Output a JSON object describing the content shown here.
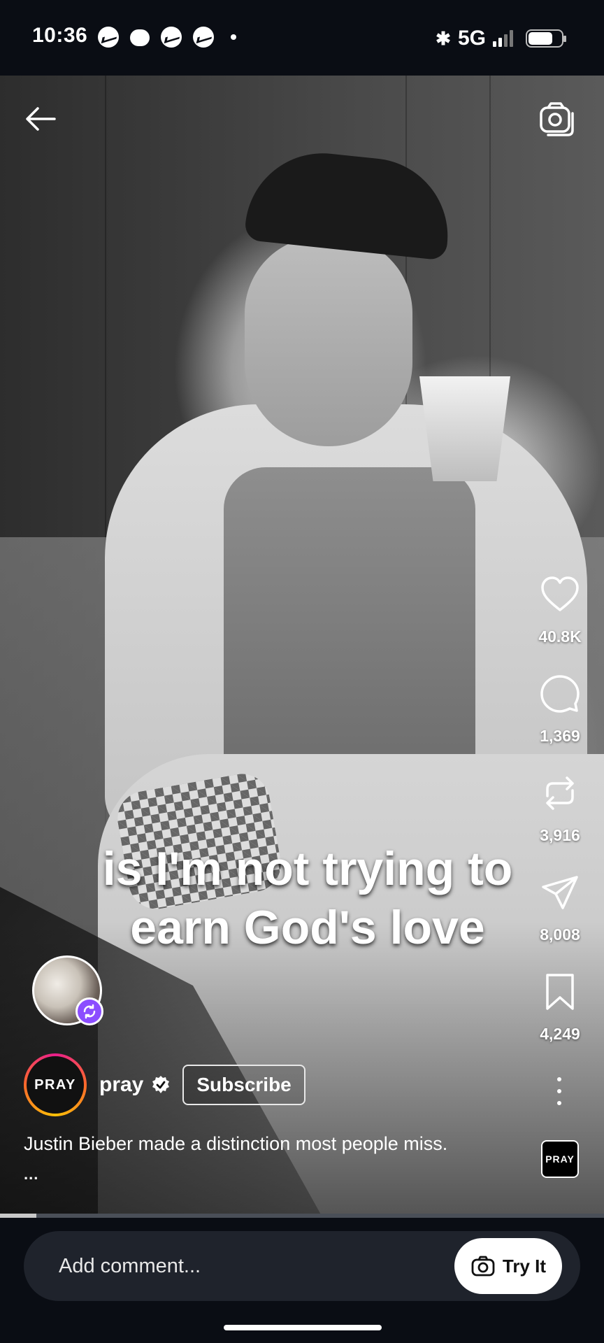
{
  "status_bar": {
    "time": "10:36",
    "network": "5G",
    "notification_icons": [
      "messenger-icon",
      "chat-icon",
      "messenger-icon",
      "messenger-icon",
      "dot-icon"
    ]
  },
  "video": {
    "caption": "is I'm not trying to earn God's love",
    "progress": 0.06
  },
  "actions": {
    "likes": "40.8K",
    "comments": "1,369",
    "reposts": "3,916",
    "shares": "8,008",
    "saves": "4,249",
    "audio_badge": "PRAY"
  },
  "author": {
    "avatar_text": "PRAY",
    "name": "pray",
    "subscribe_label": "Subscribe"
  },
  "post": {
    "description": "Justin Bieber made a distinction most people miss.",
    "more": "..."
  },
  "comment_bar": {
    "placeholder": "Add comment...",
    "try_it_label": "Try It"
  },
  "colors": {
    "background": "#0a0d14",
    "comment_bar": "#1f232c",
    "collab_badge": "#8b4dff"
  }
}
